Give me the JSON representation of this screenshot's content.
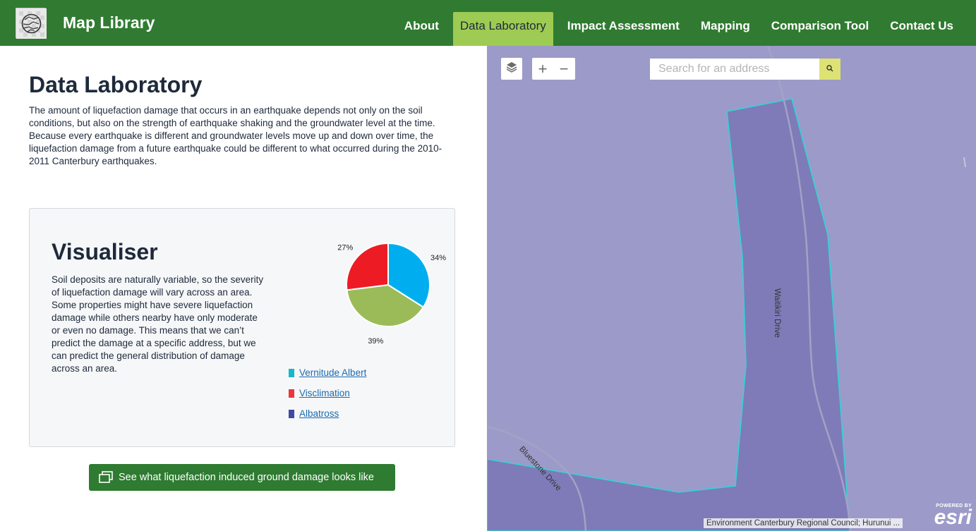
{
  "header": {
    "site_title": "Map Library",
    "nav": [
      {
        "label": "About",
        "active": false
      },
      {
        "label": "Data Laboratory",
        "active": true
      },
      {
        "label": "Impact Assessment",
        "active": false
      },
      {
        "label": "Mapping",
        "active": false
      },
      {
        "label": "Comparison Tool",
        "active": false
      },
      {
        "label": "Contact Us",
        "active": false
      }
    ],
    "brand_color": "#307b31",
    "active_color": "#9dcb53"
  },
  "main": {
    "title": "Data Laboratory",
    "intro": "The amount of liquefaction damage that occurs in an earthquake depends not only on the soil conditions, but also on the strength of earthquake shaking and the groundwater level at the time. Because every earthquake is different and groundwater levels move up and down over time, the liquefaction damage from a future earthquake could be different to what occurred during the 2010-2011 Canterbury earthquakes."
  },
  "visualiser": {
    "title": "Visualiser",
    "text": "Soil deposits are naturally variable, so the severity of liquefaction damage will vary across an area. Some properties might have severe liquefaction damage while others nearby have only moderate or even no damage. This means that we can’t predict the damage at a specific address, but we can predict the general distribution of damage across an area.",
    "legend": [
      {
        "label": "Vernitude Albert",
        "color": "#17b8c9"
      },
      {
        "label": "Visclimation",
        "color": "#e8383b"
      },
      {
        "label": "Albatross",
        "color": "#3f4aa3"
      }
    ]
  },
  "chart_data": {
    "type": "pie",
    "slices": [
      {
        "value": 34,
        "label": "34%",
        "color": "#00aeef"
      },
      {
        "value": 39,
        "label": "39%",
        "color": "#9bbb59"
      },
      {
        "value": 27,
        "label": "27%",
        "color": "#ed1c24"
      }
    ]
  },
  "cta": {
    "label": "See what liquefaction induced ground damage looks like"
  },
  "map": {
    "search_placeholder": "Search for an address",
    "layers_icon": "layers-icon",
    "zoom_in": "+",
    "zoom_out": "−",
    "roads": [
      "Waitikiri Drive",
      "Bluestone Drive"
    ],
    "attribution": "Environment Canterbury Regional Council; Hurunui ...",
    "esri_powered": "POWERED BY",
    "esri_word": "esri",
    "base_color": "#9c9ac8",
    "polygon_color": "#7f7bb8",
    "outline_color": "#2fd6d6"
  }
}
